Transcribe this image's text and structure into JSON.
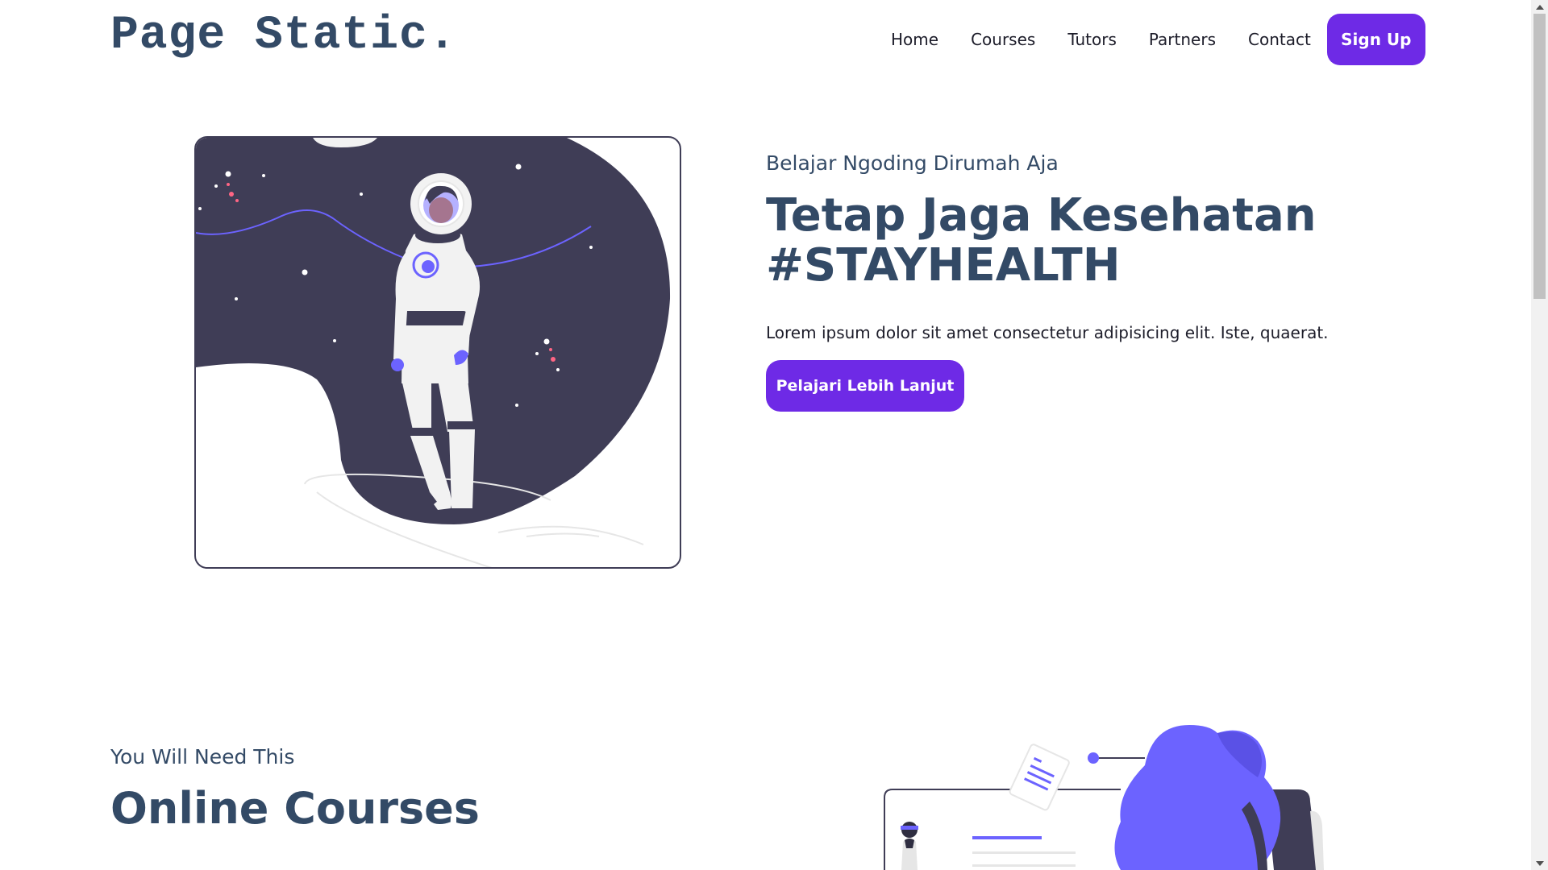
{
  "brand": {
    "logo": "Page Static."
  },
  "nav": {
    "items": [
      {
        "label": "Home"
      },
      {
        "label": "Courses"
      },
      {
        "label": "Tutors"
      },
      {
        "label": "Partners"
      },
      {
        "label": "Contact"
      }
    ],
    "signup_label": "Sign Up"
  },
  "hero": {
    "subtitle": "Belajar Ngoding Dirumah Aja",
    "title_line1": "Tetap Jaga Kesehatan",
    "title_line2": "#STAYHEALTH",
    "description": "Lorem ipsum dolor sit amet consectetur adipisicing elit. Iste, quaerat.",
    "cta_label": "Pelajari Lebih Lanjut"
  },
  "section2": {
    "subtitle": "You Will Need This",
    "title": "Online Courses"
  },
  "colors": {
    "accent": "#6e2ae6",
    "heading": "#334a66",
    "illustration_dark": "#3f3d56",
    "illustration_purple": "#6c63ff"
  }
}
